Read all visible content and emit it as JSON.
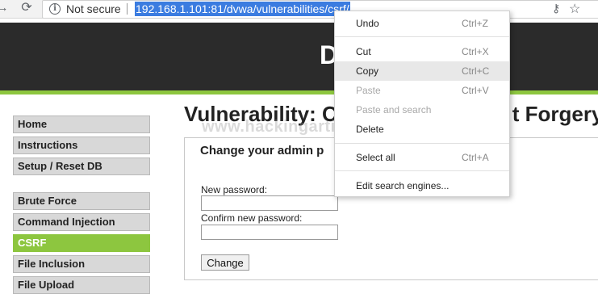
{
  "browser": {
    "security_text": "Not secure",
    "url": "192.168.1.101:81/dvwa/vulnerabilities/csrf/",
    "icons": [
      "back-arrow-icon",
      "reload-icon",
      "info-icon",
      "key-icon",
      "star-icon"
    ]
  },
  "header": {
    "logo_text": "D"
  },
  "sidebar": {
    "items": [
      {
        "label": "Home"
      },
      {
        "label": "Instructions"
      },
      {
        "label": "Setup / Reset DB"
      },
      {
        "label": "Brute Force"
      },
      {
        "label": "Command Injection"
      },
      {
        "label": "CSRF"
      },
      {
        "label": "File Inclusion"
      },
      {
        "label": "File Upload"
      }
    ],
    "active": "CSRF"
  },
  "main": {
    "title": "Vulnerability: C",
    "title_tail": "t Forgery",
    "watermark": "www.hackingarticles.in",
    "box_heading": "Change your admin p",
    "new_password_label": "New password:",
    "confirm_password_label": "Confirm new password:",
    "change_button": "Change"
  },
  "context_menu": {
    "items": [
      {
        "label": "Undo",
        "shortcut": "Ctrl+Z"
      },
      {
        "label": "Cut",
        "shortcut": "Ctrl+X"
      },
      {
        "label": "Copy",
        "shortcut": "Ctrl+C"
      },
      {
        "label": "Paste",
        "shortcut": "Ctrl+V"
      },
      {
        "label": "Paste and search",
        "shortcut": ""
      },
      {
        "label": "Delete",
        "shortcut": ""
      },
      {
        "label": "Select all",
        "shortcut": "Ctrl+A"
      },
      {
        "label": "Edit search engines...",
        "shortcut": ""
      }
    ]
  },
  "colors": {
    "accent_green": "#8dc63f",
    "header_dark": "#2b2b2b",
    "url_highlight": "#3b7ce0"
  }
}
